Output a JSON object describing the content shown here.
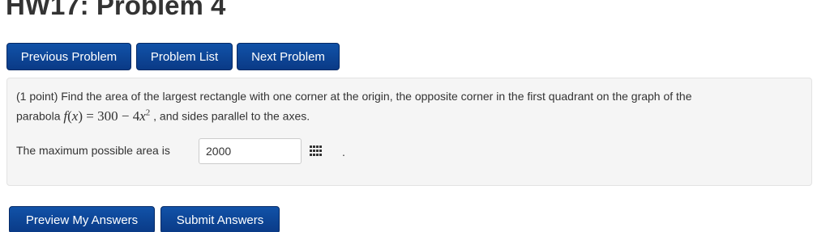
{
  "page": {
    "title": "HW17: Problem 4"
  },
  "nav": {
    "previous_label": "Previous Problem",
    "list_label": "Problem List",
    "next_label": "Next Problem"
  },
  "problem": {
    "line1": "(1 point) Find the area of the largest rectangle with one corner at the origin, the opposite corner in the first quadrant on the graph of the",
    "line2_prefix": "parabola ",
    "math": {
      "f": "f",
      "x": "x",
      "eq": " = 300 − 4",
      "exp": "2"
    },
    "line2_suffix": " , and sides parallel to the axes.",
    "answer_label": "The maximum possible area is",
    "answer_value": "2000",
    "trailing_period": ".",
    "keypad_icon": "grid-keypad-icon"
  },
  "actions": {
    "preview_label": "Preview My Answers",
    "submit_label": "Submit Answers"
  },
  "colors": {
    "button_bg": "#0e4a9e",
    "panel_bg": "#f5f5f5",
    "text": "#333333"
  }
}
